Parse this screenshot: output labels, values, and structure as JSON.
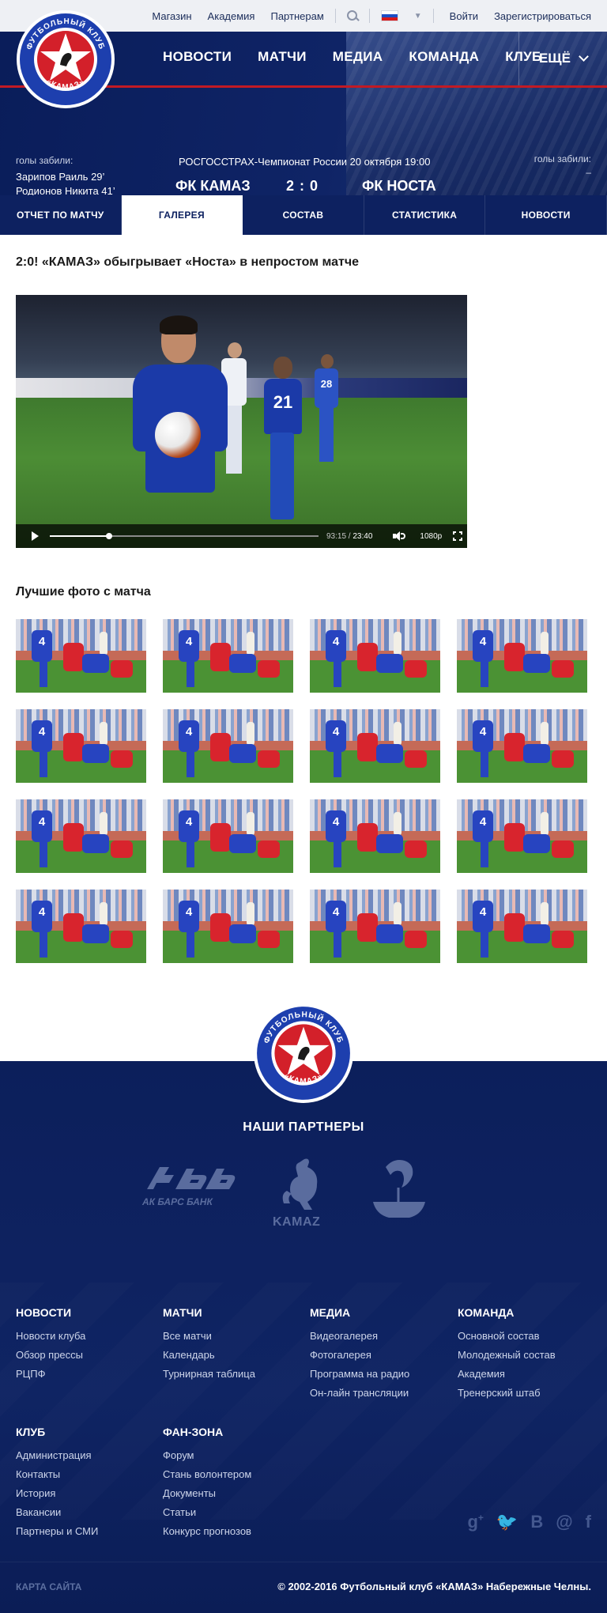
{
  "topbar": {
    "links": [
      "Магазин",
      "Академия",
      "Партнерам"
    ],
    "login": "Войти",
    "register": "Зарегистрироваться"
  },
  "logo": {
    "text": "ФУТБОЛЬНЫЙ КЛУБ «КАМАЗ»"
  },
  "nav": {
    "items": [
      "НОВОСТИ",
      "МАТЧИ",
      "МЕДИА",
      "КОМАНДА",
      "КЛУБ"
    ],
    "more": "ЕЩЁ"
  },
  "match": {
    "info": "РОСГОССТРАХ-Чемпионат России 20 октября 19:00",
    "home_team": "ФК КАМАЗ",
    "score": "2 : 0",
    "away_team": "ФК НОСТА",
    "home_scorers_label": "голы забили:",
    "home_scorers": [
      "Зарипов Раиль 29’",
      "Родионов Никита 41’"
    ],
    "away_scorers_label": "голы забили:",
    "away_scorers": "–"
  },
  "tabs": [
    "ОТЧЕТ ПО МАТЧУ",
    "ГАЛЕРЕЯ",
    "СОСТАВ",
    "СТАТИСТИКА",
    "НОВОСТИ"
  ],
  "article": {
    "title": "2:0! «КАМАЗ» обыгрывает «Носта» в непростом матче"
  },
  "video": {
    "current_time": "93:15",
    "separator": " / ",
    "duration": "23:40",
    "quality": "1080p",
    "progress": 0.22,
    "shirt_numbers": [
      "21",
      "28"
    ]
  },
  "gallery": {
    "title": "Лучшие фото с матча",
    "photo_count": 16,
    "shirt_number": "4"
  },
  "footer": {
    "partners_title": "НАШИ ПАРТНЕРЫ",
    "partners": [
      "АК БАРС БАНК",
      "KAMAZ"
    ],
    "columns": [
      {
        "heading": "НОВОСТИ",
        "items": [
          "Новости клуба",
          "Обзор прессы",
          "РЦПФ"
        ]
      },
      {
        "heading": "МАТЧИ",
        "items": [
          "Все матчи",
          "Календарь",
          "Турнирная таблица"
        ]
      },
      {
        "heading": "МЕДИА",
        "items": [
          "Видеогалерея",
          "Фотогалерея",
          "Программа на радио",
          "Он-лайн трансляции"
        ]
      },
      {
        "heading": "КОМАНДА",
        "items": [
          "Основной состав",
          "Молодежный состав",
          "Академия",
          "Тренерский штаб"
        ]
      },
      {
        "heading": "КЛУБ",
        "items": [
          "Администрация",
          "Контакты",
          "История",
          "Вакансии",
          "Партнеры и СМИ"
        ]
      },
      {
        "heading": "ФАН-ЗОНА",
        "items": [
          "Форум",
          "Стань волонтером",
          "Документы",
          "Статьи",
          "Конкурс прогнозов"
        ]
      }
    ],
    "socials": [
      "g+",
      "twitter",
      "B",
      "@",
      "f"
    ],
    "sitemap": "КАРТА САЙТА",
    "copyright": "© 2002-2016 Футбольный клуб «КАМАЗ» Набережные Челны."
  },
  "colors": {
    "primary": "#0d2160",
    "accent_red": "#c21a24",
    "footer_bg": "#0c1f5b"
  },
  "icons": [
    "search-icon",
    "ru-flag-icon",
    "chevron-down-icon",
    "play-icon",
    "volume-icon",
    "fullscreen-icon",
    "google-plus-icon",
    "twitter-icon",
    "vk-icon",
    "mail-ru-icon",
    "facebook-icon"
  ]
}
